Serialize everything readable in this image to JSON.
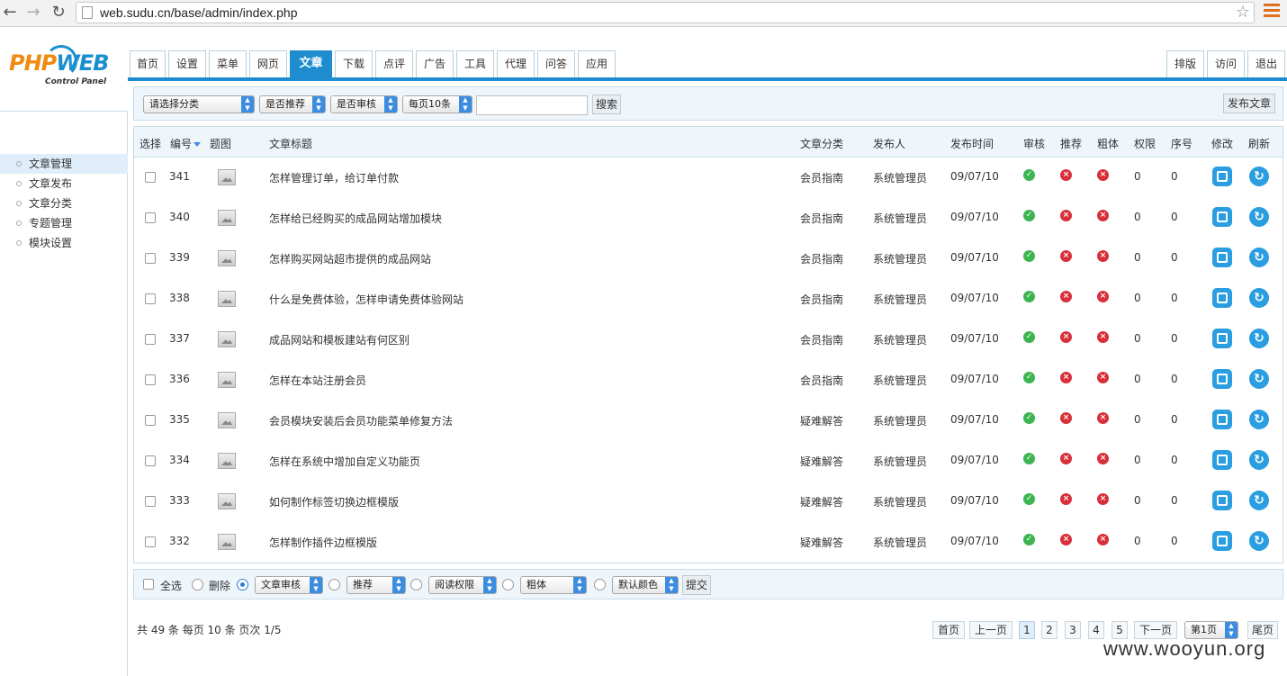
{
  "browser": {
    "url": "web.sudu.cn/base/admin/index.php"
  },
  "logo": {
    "php": "PHP",
    "web": "WEB",
    "sub": "Control Panel"
  },
  "sidebar": {
    "items": [
      {
        "label": "文章管理",
        "active": true
      },
      {
        "label": "文章发布",
        "active": false
      },
      {
        "label": "文章分类",
        "active": false
      },
      {
        "label": "专题管理",
        "active": false
      },
      {
        "label": "模块设置",
        "active": false
      }
    ]
  },
  "nav": {
    "tabs": [
      "首页",
      "设置",
      "菜单",
      "网页",
      "文章",
      "下载",
      "点评",
      "广告",
      "工具",
      "代理",
      "问答",
      "应用"
    ],
    "active": "文章",
    "right": [
      "排版",
      "访问",
      "退出"
    ]
  },
  "filters": {
    "category": "请选择分类",
    "recommend": "是否推荐",
    "audit": "是否审核",
    "perpage": "每页10条",
    "search_button": "搜索",
    "publish_button": "发布文章"
  },
  "table": {
    "headers": {
      "select": "选择",
      "id": "编号",
      "image": "题图",
      "title": "文章标题",
      "category": "文章分类",
      "author": "发布人",
      "date": "发布时间",
      "audit": "审核",
      "recommend": "推荐",
      "bold": "粗体",
      "perm": "权限",
      "order": "序号",
      "edit": "修改",
      "refresh": "刷新"
    },
    "rows": [
      {
        "id": "341",
        "title": "怎样管理订单，给订单付款",
        "category": "会员指南",
        "author": "系统管理员",
        "date": "09/07/10",
        "perm": "0",
        "order": "0"
      },
      {
        "id": "340",
        "title": "怎样给已经购买的成品网站增加模块",
        "category": "会员指南",
        "author": "系统管理员",
        "date": "09/07/10",
        "perm": "0",
        "order": "0"
      },
      {
        "id": "339",
        "title": "怎样购买网站超市提供的成品网站",
        "category": "会员指南",
        "author": "系统管理员",
        "date": "09/07/10",
        "perm": "0",
        "order": "0"
      },
      {
        "id": "338",
        "title": "什么是免费体验，怎样申请免费体验网站",
        "category": "会员指南",
        "author": "系统管理员",
        "date": "09/07/10",
        "perm": "0",
        "order": "0"
      },
      {
        "id": "337",
        "title": "成品网站和模板建站有何区别",
        "category": "会员指南",
        "author": "系统管理员",
        "date": "09/07/10",
        "perm": "0",
        "order": "0"
      },
      {
        "id": "336",
        "title": "怎样在本站注册会员",
        "category": "会员指南",
        "author": "系统管理员",
        "date": "09/07/10",
        "perm": "0",
        "order": "0"
      },
      {
        "id": "335",
        "title": "会员模块安装后会员功能菜单修复方法",
        "category": "疑难解答",
        "author": "系统管理员",
        "date": "09/07/10",
        "perm": "0",
        "order": "0"
      },
      {
        "id": "334",
        "title": "怎样在系统中增加自定义功能页",
        "category": "疑难解答",
        "author": "系统管理员",
        "date": "09/07/10",
        "perm": "0",
        "order": "0"
      },
      {
        "id": "333",
        "title": "如何制作标签切换边框模版",
        "category": "疑难解答",
        "author": "系统管理员",
        "date": "09/07/10",
        "perm": "0",
        "order": "0"
      },
      {
        "id": "332",
        "title": "怎样制作插件边框模版",
        "category": "疑难解答",
        "author": "系统管理员",
        "date": "09/07/10",
        "perm": "0",
        "order": "0"
      }
    ]
  },
  "actions": {
    "select_all": "全选",
    "delete": "删除",
    "audit_select": "文章审核",
    "recommend_select": "推荐",
    "perm_select": "阅读权限",
    "bold_select": "粗体",
    "color_select": "默认颜色",
    "submit": "提交"
  },
  "pagination": {
    "info": "共 49 条 每页 10 条 页次 1/5",
    "first": "首页",
    "prev": "上一页",
    "pages": [
      "1",
      "2",
      "3",
      "4",
      "5"
    ],
    "current": "1",
    "next": "下一页",
    "jump": "第1页",
    "last": "尾页"
  },
  "watermark": "www.wooyun.org",
  "colors": {
    "accent": "#1e8ccf",
    "ok": "#3cb550",
    "no": "#d8303a"
  }
}
